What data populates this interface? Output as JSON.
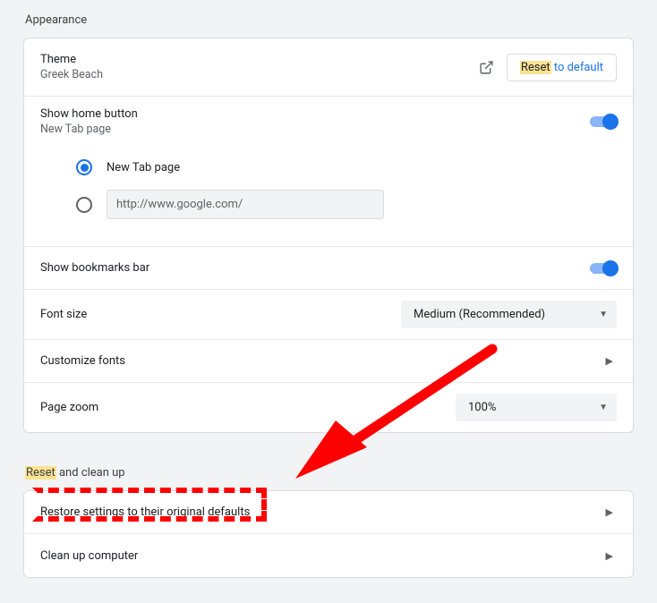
{
  "section1": {
    "title": "Appearance",
    "theme": {
      "label": "Theme",
      "value": "Greek Beach",
      "reset_hl": "Reset",
      "reset_suffix": " to default"
    },
    "home": {
      "label": "Show home button",
      "sub": "New Tab page",
      "opt1": "New Tab page",
      "url_value": "http://www.google.com/"
    },
    "bookmarks_label": "Show bookmarks bar",
    "fontsize": {
      "label": "Font size",
      "value": "Medium (Recommended)"
    },
    "customize_fonts": "Customize fonts",
    "pagezoom": {
      "label": "Page zoom",
      "value": "100%"
    }
  },
  "section2": {
    "title_hl": "Reset",
    "title_suffix": " and clean up",
    "restore": "Restore settings to their original defaults",
    "cleanup": "Clean up computer"
  }
}
